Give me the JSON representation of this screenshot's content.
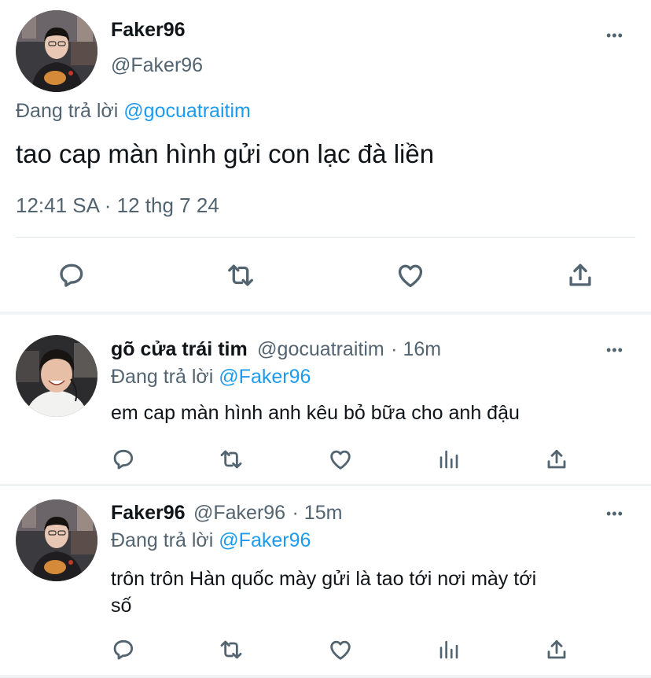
{
  "main_tweet": {
    "author_name": "Faker96",
    "author_handle": "@Faker96",
    "reply_prefix": "Đang trả lời",
    "reply_to": "@gocuatraitim",
    "text": "tao cap màn hình gửi con lạc đà liền",
    "timestamp": "12:41 SA · 12 thg 7 24",
    "more": "•••"
  },
  "replies": [
    {
      "author_name": "gõ cửa trái tim",
      "author_handle": "@gocuatraitim",
      "time": "· 16m",
      "reply_prefix": "Đang trả lời",
      "reply_to": "@Faker96",
      "text": "em cap màn hình anh kêu bỏ bữa cho anh đậu",
      "more": "•••"
    },
    {
      "author_name": "Faker96",
      "author_handle": "@Faker96",
      "time": "· 15m",
      "reply_prefix": "Đang trả lời",
      "reply_to": "@Faker96",
      "text_line1": "trôn trôn Hàn quốc mày gửi là tao tới nơi mày tới",
      "text_line2": "số",
      "more": "•••"
    }
  ],
  "icons": [
    "reply-icon",
    "retweet-icon",
    "like-icon",
    "views-icon",
    "share-icon",
    "more-icon"
  ],
  "colors": {
    "link": "#1d9bf0",
    "muted": "#536471",
    "text": "#0f1419",
    "divider": "#eff3f4"
  }
}
